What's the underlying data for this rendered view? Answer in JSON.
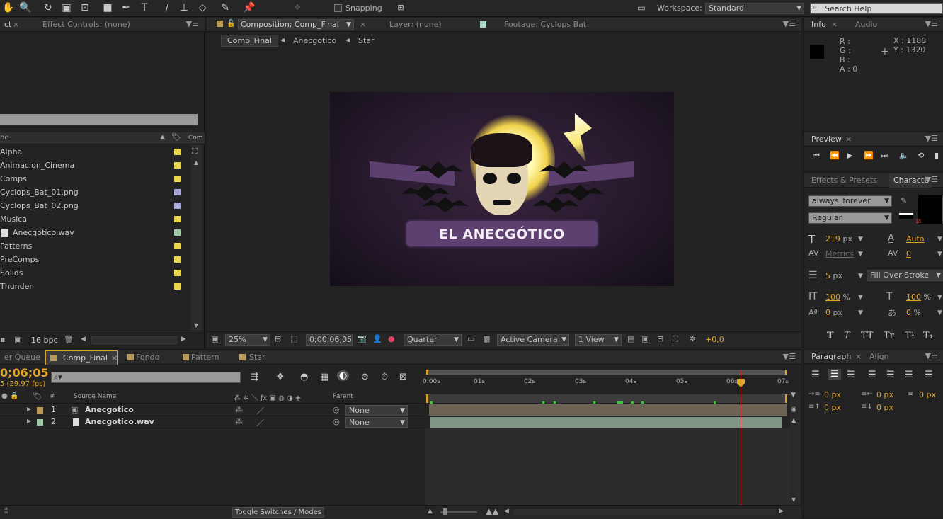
{
  "toolbar": {
    "snapping": "Snapping",
    "workspace_label": "Workspace:",
    "workspace_value": "Standard",
    "search_placeholder": "Search Help"
  },
  "project": {
    "tab_left": "ct",
    "tab_effects": "Effect Controls: (none)",
    "col_name": "ne",
    "col_com": "Com",
    "bpc": "16 bpc",
    "items": [
      {
        "name": "Alpha",
        "color": "#e8d44d"
      },
      {
        "name": "Animacion_Cinema",
        "color": "#e8d44d"
      },
      {
        "name": "Comps",
        "color": "#e8d44d"
      },
      {
        "name": "Cyclops_Bat_01.png",
        "color": "#a8a8d6"
      },
      {
        "name": "Cyclops_Bat_02.png",
        "color": "#a8a8d6"
      },
      {
        "name": "Musica",
        "color": "#e8d44d"
      },
      {
        "name": "Anecgotico.wav",
        "color": "#9fc7a8"
      },
      {
        "name": "Patterns",
        "color": "#e8d44d"
      },
      {
        "name": "PreComps",
        "color": "#e8d44d"
      },
      {
        "name": "Solids",
        "color": "#e8d44d"
      },
      {
        "name": "Thunder",
        "color": "#e8d44d"
      }
    ]
  },
  "comp": {
    "tab": "Composition: Comp_Final",
    "layer_tab": "Layer: (none)",
    "footage_tab": "Footage: Cyclops Bat",
    "crumbs": [
      "Comp_Final",
      "Anecgotico",
      "Star"
    ],
    "title_text": "EL ANECGÓTICO",
    "zoom": "25%",
    "timecode": "0;00;06;05",
    "quality": "Quarter",
    "camera": "Active Camera",
    "views": "1 View",
    "exposure": "+0,0"
  },
  "info": {
    "tab": "Info",
    "audio_tab": "Audio",
    "r": "R :",
    "g": "G :",
    "b": "B :",
    "a": "A :  0",
    "x": "X : 1188",
    "y": "Y : 1320"
  },
  "preview": {
    "tab": "Preview"
  },
  "character": {
    "effects_tab": "Effects & Presets",
    "char_tab": "Characte",
    "font": "always_forever",
    "style": "Regular",
    "size": "219",
    "size_unit": "px",
    "leading": "Auto",
    "kerning": "Metrics",
    "tracking": "0",
    "stroke": "5",
    "stroke_unit": "px",
    "stroke_mode": "Fill Over Stroke",
    "vscale": "100",
    "hscale": "100",
    "baseline": "0",
    "baseline_unit": "px",
    "tsume": "0",
    "pct": "%",
    "buttons": [
      "T",
      "T",
      "TT",
      "Tr",
      "T¹",
      "T₁"
    ]
  },
  "paragraph": {
    "tab": "Paragraph",
    "align_tab": "Align",
    "vals": [
      "0 px",
      "0 px",
      "0 px",
      "0 px",
      "0 px"
    ]
  },
  "timeline": {
    "tabs": [
      "er Queue",
      "Comp_Final",
      "Fondo",
      "Pattern",
      "Star"
    ],
    "timecode": "0;06;05",
    "fps": "5 (29.97 fps)",
    "col_source": "Source Name",
    "col_parent": "Parent",
    "col_num": "#",
    "layers": [
      {
        "num": "1",
        "name": "Anecgotico",
        "parent": "None"
      },
      {
        "num": "2",
        "name": "Anecgotico.wav",
        "parent": "None"
      }
    ],
    "ruler": [
      "0:00s",
      "01s",
      "02s",
      "03s",
      "04s",
      "05s",
      "06s",
      "07s"
    ],
    "toggle": "Toggle Switches / Modes",
    "playhead_fraction": 0.88
  }
}
